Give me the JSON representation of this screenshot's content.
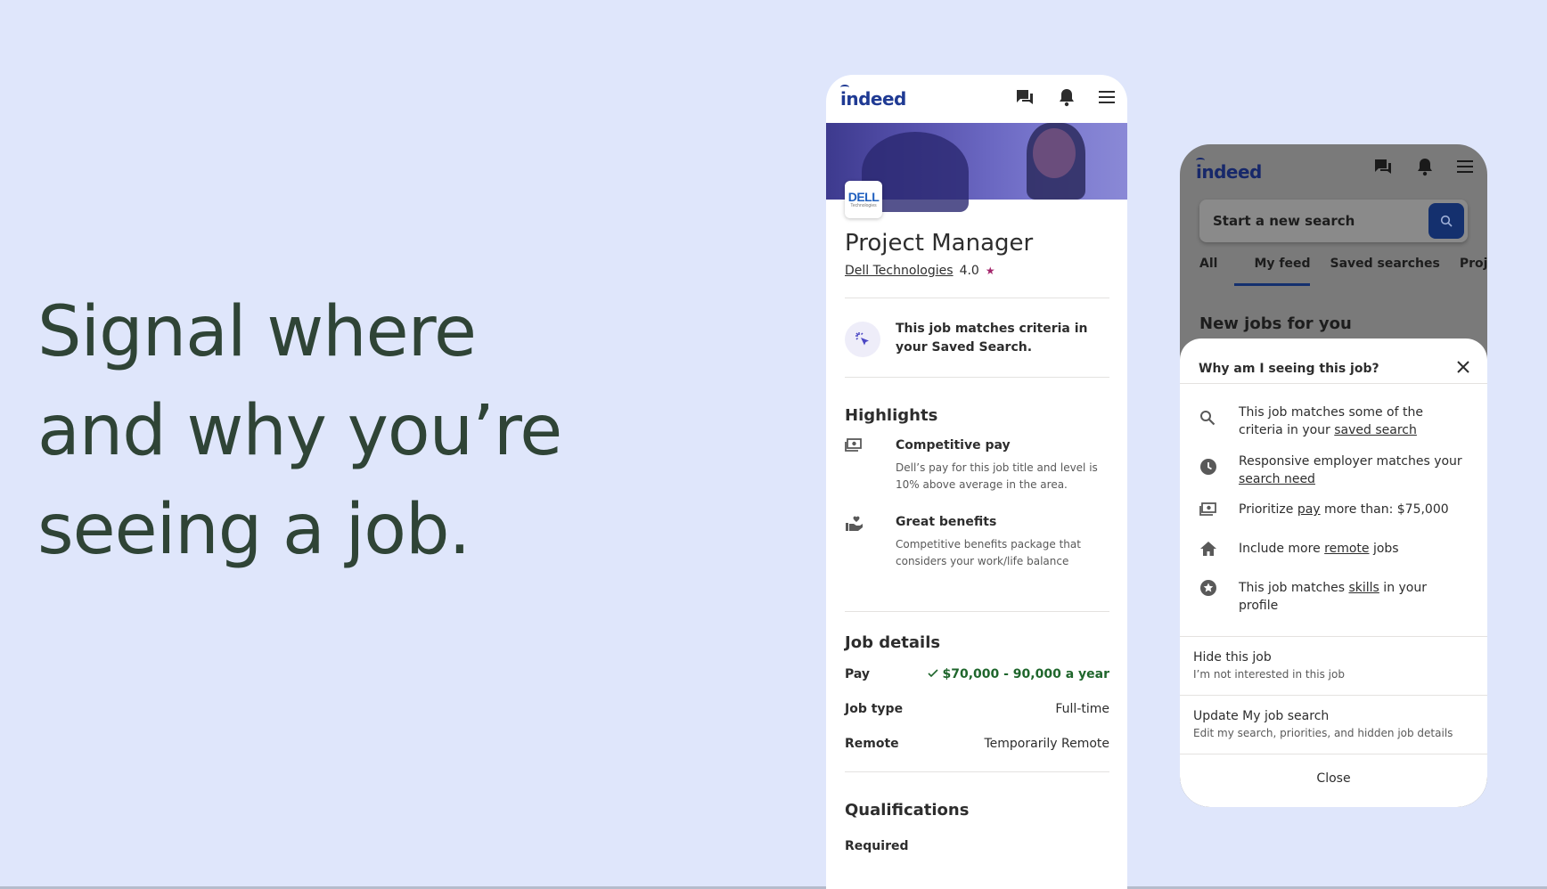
{
  "hero": {
    "line1": "Signal where",
    "line2": "and why you’re",
    "line3": "seeing a job."
  },
  "brand": {
    "logo": "indeed",
    "accent": "#1f3a93",
    "dark_navy": "#14306e"
  },
  "job_page": {
    "company_logo_text": "DELL",
    "company_logo_sub": "Technologies",
    "title": "Project Manager",
    "company": "Dell Technologies",
    "rating": "4.0",
    "rating_icon": "★",
    "match_text": "This job matches criteria in your Saved Search.",
    "highlights_heading": "Highlights",
    "highlights": [
      {
        "icon": "money-icon",
        "title": "Competitive pay",
        "desc": "Dell’s pay for this job title and level is 10% above average in the area."
      },
      {
        "icon": "benefits-icon",
        "title": "Great benefits",
        "desc": "Competitive benefits package that considers your work/life balance"
      }
    ],
    "details_heading": "Job details",
    "details": [
      {
        "label": "Pay",
        "value": "$70,000 - 90,000 a year"
      },
      {
        "label": "Job type",
        "value": "Full-time"
      },
      {
        "label": "Remote",
        "value": "Temporarily Remote"
      }
    ],
    "qualifications_heading": "Qualifications",
    "required_label": "Required"
  },
  "feed_page": {
    "search_placeholder": "Start a new search",
    "tabs": [
      "All",
      "My feed",
      "Saved searches",
      "Projec"
    ],
    "new_jobs_heading": "New jobs for you",
    "sheet": {
      "title": "Why am I seeing this job?",
      "reasons": [
        {
          "icon": "search-icon",
          "pre": "This job matches some of the criteria in your ",
          "link": "saved search",
          "post": ""
        },
        {
          "icon": "clock-icon",
          "pre": "Responsive employer matches your ",
          "link": "search need",
          "post": ""
        },
        {
          "icon": "money-icon",
          "pre": "Prioritize ",
          "link": "pay",
          "post": " more than: $75,000"
        },
        {
          "icon": "home-icon",
          "pre": "Include more ",
          "link": "remote",
          "post": " jobs"
        },
        {
          "icon": "star-icon",
          "pre": "This job matches ",
          "link": "skills",
          "post": " in your profile"
        }
      ],
      "actions": [
        {
          "title": "Hide this job",
          "subtitle": "I’m not interested in this job"
        },
        {
          "title": "Update My job search",
          "subtitle": "Edit my search, priorities, and hidden job details"
        }
      ],
      "close_label": "Close"
    }
  }
}
